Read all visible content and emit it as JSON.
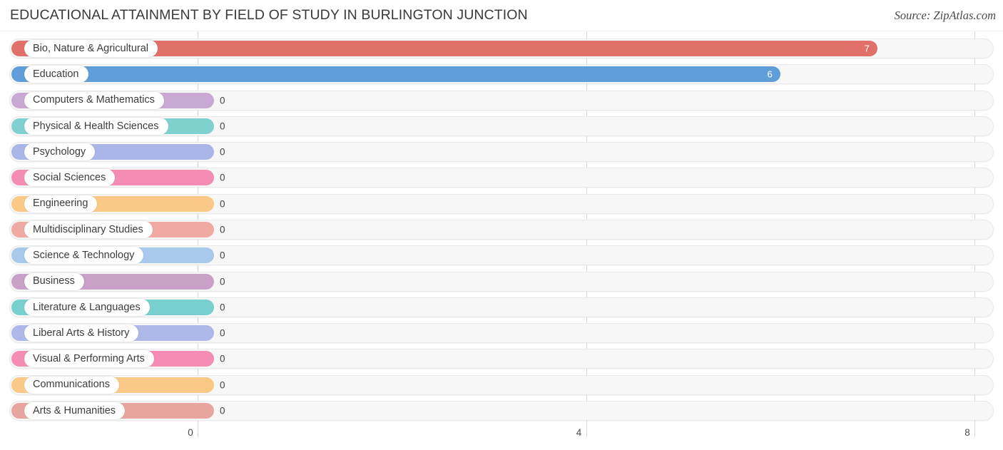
{
  "header": {
    "title": "EDUCATIONAL ATTAINMENT BY FIELD OF STUDY IN BURLINGTON JUNCTION",
    "source": "Source: ZipAtlas.com"
  },
  "chart_data": {
    "type": "bar",
    "orientation": "horizontal",
    "title": "EDUCATIONAL ATTAINMENT BY FIELD OF STUDY IN BURLINGTON JUNCTION",
    "subtitle": "",
    "xlabel": "",
    "ylabel": "",
    "xlim": [
      0,
      8
    ],
    "xticks": [
      "0",
      "4",
      "8"
    ],
    "xtick_values": [
      0,
      4,
      8
    ],
    "grid": true,
    "legend": false,
    "categories": [
      "Bio, Nature & Agricultural",
      "Education",
      "Computers & Mathematics",
      "Physical & Health Sciences",
      "Psychology",
      "Social Sciences",
      "Engineering",
      "Multidisciplinary Studies",
      "Science & Technology",
      "Business",
      "Literature & Languages",
      "Liberal Arts & History",
      "Visual & Performing Arts",
      "Communications",
      "Arts & Humanities"
    ],
    "values": [
      7,
      6,
      0,
      0,
      0,
      0,
      0,
      0,
      0,
      0,
      0,
      0,
      0,
      0,
      0
    ],
    "value_labels": [
      "7",
      "6",
      "0",
      "0",
      "0",
      "0",
      "0",
      "0",
      "0",
      "0",
      "0",
      "0",
      "0",
      "0",
      "0"
    ],
    "colors": [
      "#e2706a",
      "#5f9ed8",
      "#c9a8d4",
      "#7ed1cf",
      "#aab6e8",
      "#f58cb4",
      "#fbc987",
      "#f0a9a3",
      "#a8c8ec",
      "#c9a1c8",
      "#77d0cd",
      "#aeb8e9",
      "#f58cb4",
      "#fbc987",
      "#e8a49f"
    ]
  }
}
